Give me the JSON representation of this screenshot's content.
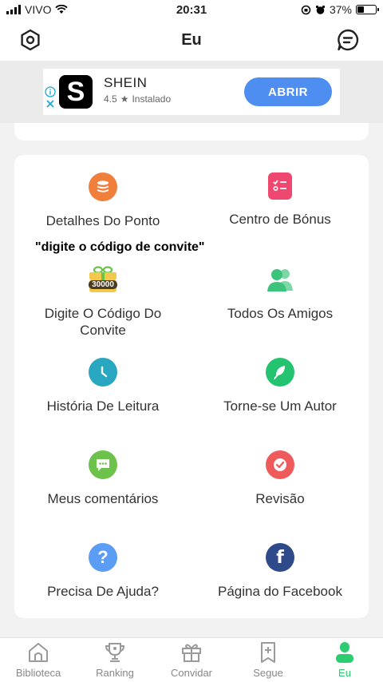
{
  "status_bar": {
    "carrier": "VIVO",
    "time": "20:31",
    "battery": "37%",
    "battery_level": 0.37
  },
  "header": {
    "title": "Eu"
  },
  "ad": {
    "app_name": "SHEIN",
    "logo_letter": "S",
    "rating": "4.5",
    "status": "Instalado",
    "cta_label": "ABRIR"
  },
  "annotation": "\"digite o código de convite\"",
  "menu": {
    "items": [
      {
        "label": "Detalhes Do Ponto",
        "icon": "coins-icon",
        "color": "#f07f3c"
      },
      {
        "label": "Centro de Bónus",
        "icon": "checklist-icon",
        "color": "#ee4770"
      },
      {
        "label": "Digite O Código Do Convite",
        "icon": "gift-30000-icon",
        "color": "#5a4a2a",
        "badge": "30000"
      },
      {
        "label": "Todos Os Amigos",
        "icon": "friends-icon",
        "color": "#3cc47c"
      },
      {
        "label": "História De Leitura",
        "icon": "clock-icon",
        "color": "#2aa7c0"
      },
      {
        "label": "Torne-se Um Autor",
        "icon": "feather-icon",
        "color": "#23c36f"
      },
      {
        "label": "Meus comentários",
        "icon": "comment-icon",
        "color": "#6cc24a"
      },
      {
        "label": "Revisão",
        "icon": "review-icon",
        "color": "#ef5a5a"
      },
      {
        "label": "Precisa De Ajuda?",
        "icon": "help-icon",
        "color": "#5b9cf5"
      },
      {
        "label": "Página do Facebook",
        "icon": "facebook-icon",
        "color": "#2f4a8a"
      }
    ]
  },
  "bottom_nav": {
    "items": [
      {
        "label": "Biblioteca",
        "icon": "home-icon"
      },
      {
        "label": "Ranking",
        "icon": "trophy-icon"
      },
      {
        "label": "Convidar",
        "icon": "gift-icon"
      },
      {
        "label": "Segue",
        "icon": "bookmark-add-icon"
      },
      {
        "label": "Eu",
        "icon": "user-icon",
        "active": true
      }
    ]
  },
  "colors": {
    "accent": "#2ecc71",
    "ad_button": "#4d8ef0"
  }
}
